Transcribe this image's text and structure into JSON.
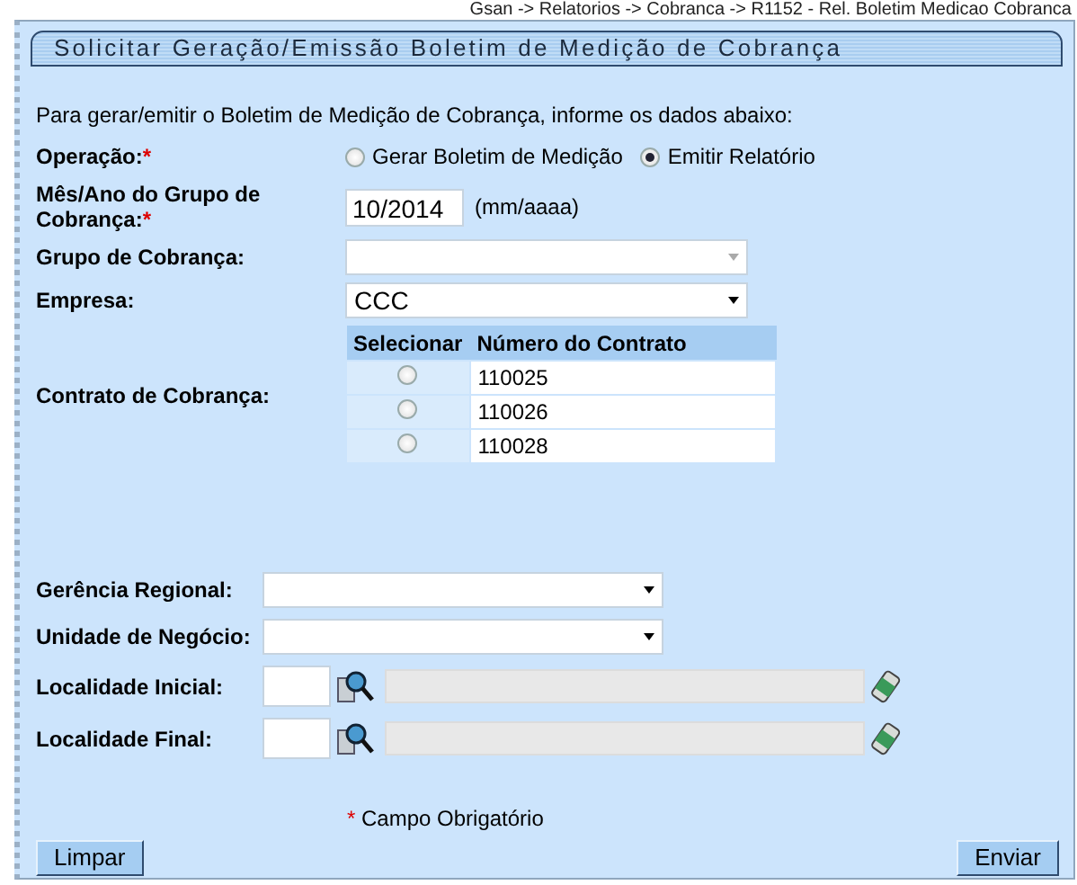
{
  "breadcrumb": "Gsan -> Relatorios -> Cobranca -> R1152 - Rel. Boletim Medicao Cobranca",
  "title": "Solicitar Geração/Emissão Boletim de Medição de Cobrança",
  "intro": "Para gerar/emitir o Boletim de Medição de Cobrança, informe os dados abaixo:",
  "fields": [
    {
      "kind": "radio",
      "label": "Operação:",
      "required_mark": "*",
      "options": [
        {
          "label": "Gerar Boletim de Medição",
          "selected": false
        },
        {
          "label": "Emitir Relatório",
          "selected": true
        }
      ]
    },
    {
      "kind": "text",
      "label": "Mês/Ano do Grupo de Cobrança:",
      "required_mark": "*",
      "value": "10/2014",
      "hint": "(mm/aaaa)"
    },
    {
      "kind": "select",
      "label": "Grupo de Cobrança:",
      "disabled": true
    },
    {
      "kind": "select",
      "label": "Empresa:",
      "value": "CCC",
      "disabled": false
    },
    {
      "kind": "table",
      "label": "Contrato de Cobrança:",
      "columns": [
        "Selecionar",
        "Número do Contrato"
      ],
      "rows": [
        {
          "number": "110025",
          "selected": false
        },
        {
          "number": "110026",
          "selected": false
        },
        {
          "number": "110028",
          "selected": false
        }
      ]
    }
  ],
  "filters": [
    {
      "kind": "select",
      "label": "Gerência Regional:",
      "disabled": false
    },
    {
      "kind": "select",
      "label": "Unidade de Negócio:",
      "disabled": false
    },
    {
      "kind": "lookup",
      "label": "Localidade Inicial:"
    },
    {
      "kind": "lookup",
      "label": "Localidade Final:"
    }
  ],
  "required_note": {
    "mark": "*",
    "text": "Campo Obrigatório"
  },
  "buttons": {
    "clear": "Limpar",
    "submit": "Enviar"
  }
}
